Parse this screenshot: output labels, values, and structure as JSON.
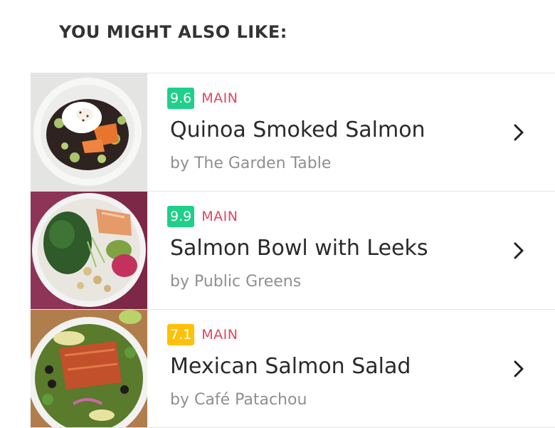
{
  "section": {
    "title": "YOU MIGHT ALSO LIKE:"
  },
  "colors": {
    "score_high": "#1fcf8a",
    "score_mid": "#ffc107",
    "tag": "#e04560"
  },
  "recipes": [
    {
      "score": "9.6",
      "score_level": "high",
      "category": "MAIN",
      "title": "Quinoa Smoked Salmon",
      "byline": "by The Garden Table"
    },
    {
      "score": "9.9",
      "score_level": "high",
      "category": "MAIN",
      "title": "Salmon Bowl with Leeks",
      "byline": "by Public Greens"
    },
    {
      "score": "7.1",
      "score_level": "mid",
      "category": "MAIN",
      "title": "Mexican Salmon Salad",
      "byline": "by Café Patachou"
    }
  ]
}
